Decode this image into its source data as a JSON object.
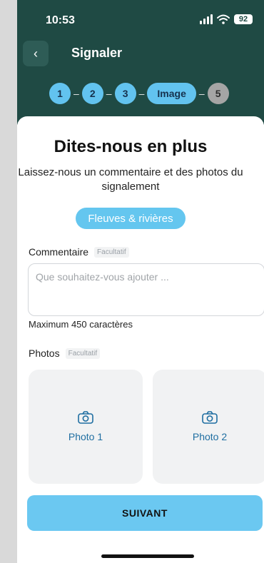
{
  "status_bar": {
    "time": "10:53",
    "battery": "92"
  },
  "header": {
    "title": "Signaler",
    "back_icon": "chevron-left-icon"
  },
  "stepper": {
    "steps": [
      "1",
      "2",
      "3",
      "Image",
      "5"
    ],
    "separator": "–"
  },
  "content": {
    "heading": "Dites-nous en plus",
    "subtitle": "Laissez-nous un commentaire et des photos du signalement",
    "category": "Fleuves & rivières"
  },
  "comment": {
    "label": "Commentaire",
    "optional": "Facultatif",
    "placeholder": "Que souhaitez-vous ajouter ...",
    "help": "Maximum 450 caractères"
  },
  "photos": {
    "label": "Photos",
    "optional": "Facultatif",
    "items": [
      {
        "label": "Photo 1",
        "icon": "camera-icon"
      },
      {
        "label": "Photo 2",
        "icon": "camera-icon"
      }
    ]
  },
  "actions": {
    "next": "SUIVANT"
  },
  "colors": {
    "header_bg": "#1f4a44",
    "accent": "#64c6ef",
    "step_todo": "#a5a5a5"
  }
}
